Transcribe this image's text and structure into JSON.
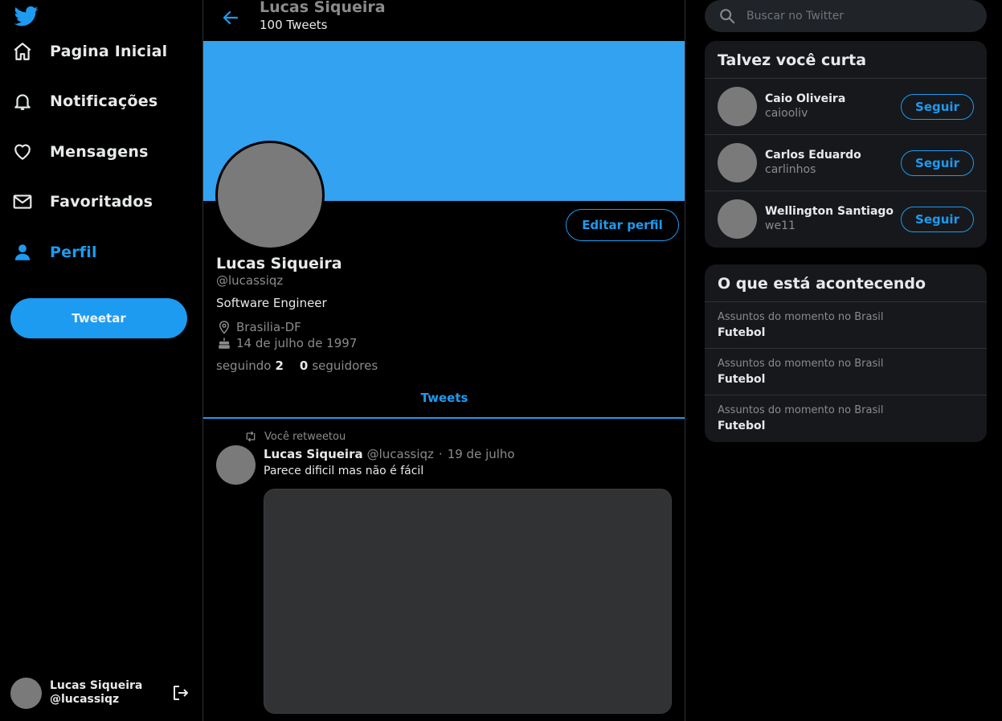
{
  "sidebar": {
    "logo": "twitter-bird-icon",
    "items": [
      {
        "label": "Pagina Inicial",
        "icon": "home-icon"
      },
      {
        "label": "Notificações",
        "icon": "bell-icon"
      },
      {
        "label": "Mensagens",
        "icon": "heart-icon"
      },
      {
        "label": "Favoritados",
        "icon": "mail-icon"
      },
      {
        "label": "Perfil",
        "icon": "person-icon",
        "active": true
      }
    ],
    "tweet_button": "Tweetar",
    "account": {
      "name": "Lucas Siqueira",
      "handle": "@lucassiqz"
    }
  },
  "header": {
    "name": "Lucas Siqueira",
    "tweet_count": "100 Tweets"
  },
  "profile": {
    "edit_button": "Editar perfil",
    "name": "Lucas Siqueira",
    "handle": "@lucassiqz",
    "bio": "Software Engineer",
    "location": "Brasilia-DF",
    "birthday": "14 de julho de 1997",
    "following_label": "seguindo",
    "following_count": "2",
    "followers_count": "0",
    "followers_label": "seguidores"
  },
  "tabs": [
    {
      "label": "Tweets",
      "active": true
    }
  ],
  "tweet": {
    "retweet_note": "Você retweetou",
    "author": "Lucas Siqueira",
    "handle": "@lucassiqz",
    "separator": "·",
    "date": "19 de julho",
    "text": "Parece dificil mas não é fácil"
  },
  "search": {
    "placeholder": "Buscar no Twitter"
  },
  "suggestions": {
    "title": "Talvez você curta",
    "follow_label": "Seguir",
    "users": [
      {
        "name": "Caio Oliveira",
        "handle": "caiooliv"
      },
      {
        "name": "Carlos Eduardo",
        "handle": "carlinhos"
      },
      {
        "name": "Wellington Santiago",
        "handle": "we11"
      }
    ]
  },
  "trends": {
    "title": "O que está acontecendo",
    "items": [
      {
        "context": "Assuntos do momento no Brasil",
        "topic": "Futebol"
      },
      {
        "context": "Assuntos do momento no Brasil",
        "topic": "Futebol"
      },
      {
        "context": "Assuntos do momento no Brasil",
        "topic": "Futebol"
      }
    ]
  },
  "colors": {
    "accent": "#1d9bf0",
    "banner": "#32a2f1",
    "background": "#000000",
    "panel": "#16181c"
  }
}
